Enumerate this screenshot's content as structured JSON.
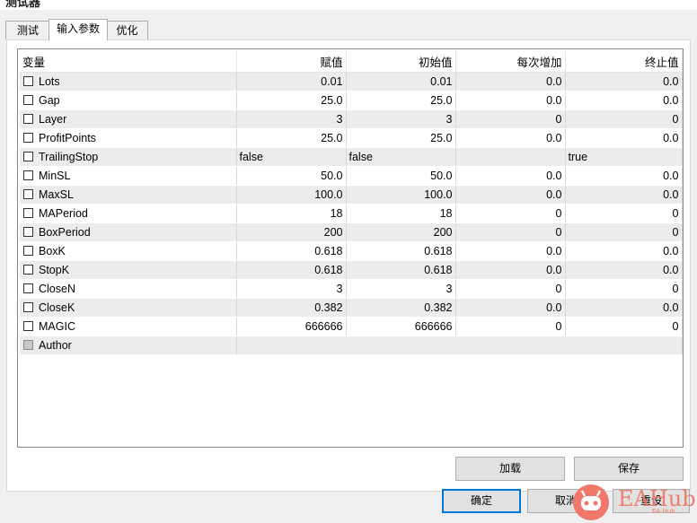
{
  "window": {
    "title": "测试器"
  },
  "tabs": [
    {
      "label": "测试",
      "active": false
    },
    {
      "label": "输入参数",
      "active": true
    },
    {
      "label": "优化",
      "active": false
    }
  ],
  "grid": {
    "columns": [
      "变量",
      "赋值",
      "初始值",
      "每次增加",
      "终止值"
    ],
    "rows": [
      {
        "name": "Lots",
        "value": "0.01",
        "start": "0.01",
        "step": "0.0",
        "stop": "0.0"
      },
      {
        "name": "Gap",
        "value": "25.0",
        "start": "25.0",
        "step": "0.0",
        "stop": "0.0"
      },
      {
        "name": "Layer",
        "value": "3",
        "start": "3",
        "step": "0",
        "stop": "0"
      },
      {
        "name": "ProfitPoints",
        "value": "25.0",
        "start": "25.0",
        "step": "0.0",
        "stop": "0.0"
      },
      {
        "name": "TrailingStop",
        "value": "false",
        "start": "false",
        "step": "",
        "stop": "true"
      },
      {
        "name": "MinSL",
        "value": "50.0",
        "start": "50.0",
        "step": "0.0",
        "stop": "0.0"
      },
      {
        "name": "MaxSL",
        "value": "100.0",
        "start": "100.0",
        "step": "0.0",
        "stop": "0.0"
      },
      {
        "name": "MAPeriod",
        "value": "18",
        "start": "18",
        "step": "0",
        "stop": "0"
      },
      {
        "name": "BoxPeriod",
        "value": "200",
        "start": "200",
        "step": "0",
        "stop": "0"
      },
      {
        "name": "BoxK",
        "value": "0.618",
        "start": "0.618",
        "step": "0.0",
        "stop": "0.0"
      },
      {
        "name": "StopK",
        "value": "0.618",
        "start": "0.618",
        "step": "0.0",
        "stop": "0.0"
      },
      {
        "name": "CloseN",
        "value": "3",
        "start": "3",
        "step": "0",
        "stop": "0"
      },
      {
        "name": "CloseK",
        "value": "0.382",
        "start": "0.382",
        "step": "0.0",
        "stop": "0.0"
      },
      {
        "name": "MAGIC",
        "value": "666666",
        "start": "666666",
        "step": "0",
        "stop": "0"
      }
    ],
    "author_row": {
      "name": "Author",
      "value": ""
    }
  },
  "buttons": {
    "load": "加载",
    "save": "保存",
    "ok": "确定",
    "cancel": "取消",
    "reset": "重设"
  },
  "watermark": {
    "text": "EAHub",
    "sub": "EA Hub"
  },
  "colors": {
    "accent": "#0078d7",
    "row_alt": "#ececec",
    "watermark": "#f0776a"
  }
}
